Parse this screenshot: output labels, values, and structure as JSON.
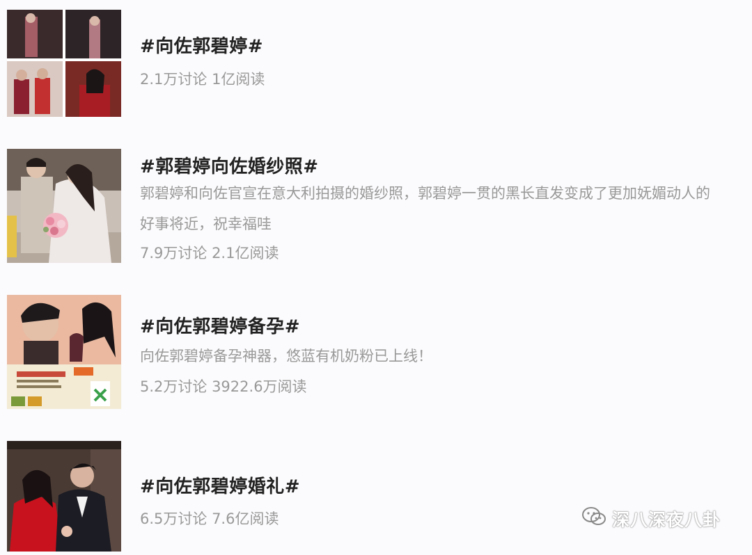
{
  "topics": [
    {
      "title": "#向佐郭碧婷#",
      "description": [],
      "stats": "2.1万讨论 1亿阅读",
      "thumbnail": "photo-collage-icon"
    },
    {
      "title": "#郭碧婷向佐婚纱照#",
      "description": [
        "郭碧婷和向佐官宣在意大利拍摄的婚纱照，郭碧婷一贯的黑长直发变成了更加妩媚动人的",
        "好事将近，祝幸福哇"
      ],
      "stats": "7.9万讨论 2.1亿阅读",
      "thumbnail": "wedding-photo-icon"
    },
    {
      "title": "#向佐郭碧婷备孕#",
      "description": [
        "向佐郭碧婷备孕神器，悠蓝有机奶粉已上线！"
      ],
      "stats": "5.2万讨论 3922.6万阅读",
      "thumbnail": "ad-poster-icon"
    },
    {
      "title": "#向佐郭碧婷婚礼#",
      "description": [],
      "stats": "6.5万讨论 7.6亿阅读",
      "thumbnail": "couple-photo-icon"
    }
  ],
  "watermark": {
    "label": "深八深夜八卦",
    "icon": "wechat-icon"
  }
}
